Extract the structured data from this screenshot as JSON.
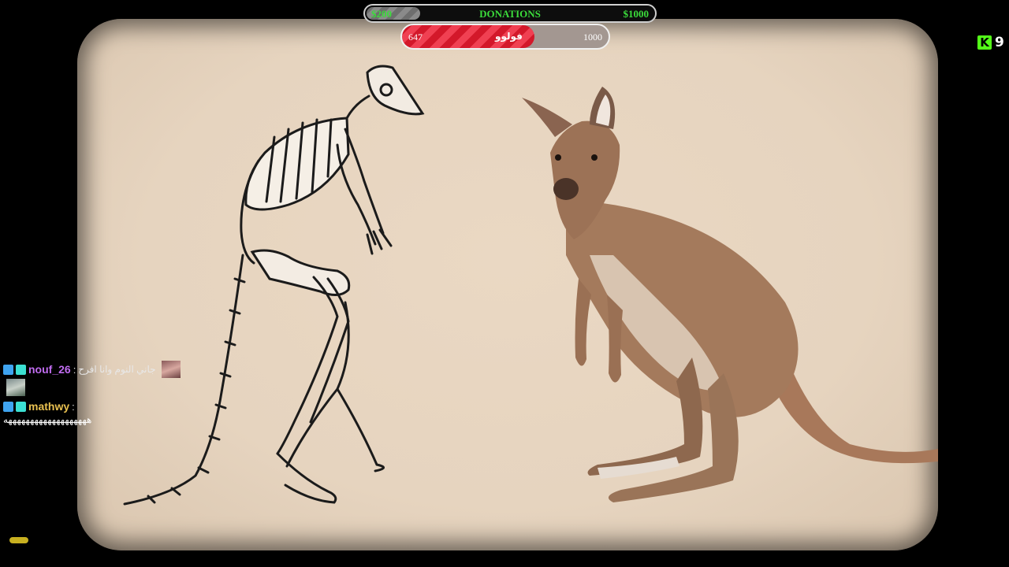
{
  "donations": {
    "title": "DONATIONS",
    "current": "$200",
    "goal": "$1000",
    "progress": 0.2
  },
  "follows": {
    "current": "647",
    "label": "فولوو",
    "goal": "1000",
    "progress": 0.647
  },
  "viewers": {
    "icon": "kick-icon",
    "count": "9"
  },
  "chat": [
    {
      "username": "nouf_26",
      "separator": ":",
      "message": "جاني النوم وانا افرح"
    },
    {
      "username": "mathwy",
      "separator": ":",
      "message": "هههههههههههههههههههه"
    }
  ],
  "colors": {
    "accent_green": "#3bdc3b",
    "follow_red": "#d3182a",
    "kick_green": "#53fc18"
  }
}
